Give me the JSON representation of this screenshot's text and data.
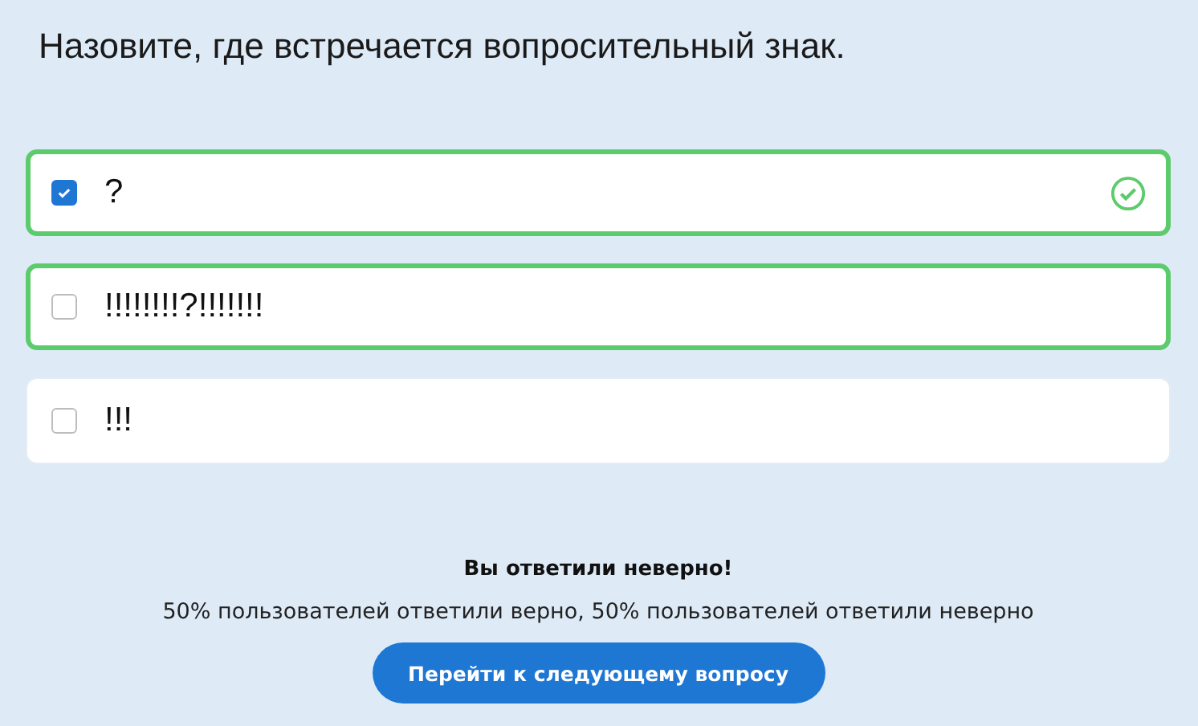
{
  "question": "Назовите, где встречается вопросительный знак.",
  "options": [
    {
      "label": "?",
      "checked": true,
      "correct": true
    },
    {
      "label": "!!!!!!!!?!!!!!!!",
      "checked": false,
      "correct": true
    },
    {
      "label": "!!!",
      "checked": false,
      "correct": false
    }
  ],
  "result": {
    "title": "Вы ответили неверно!",
    "stats": "50% пользователей ответили верно, 50% пользователей ответили неверно"
  },
  "next_button": "Перейти к следующему вопросу"
}
